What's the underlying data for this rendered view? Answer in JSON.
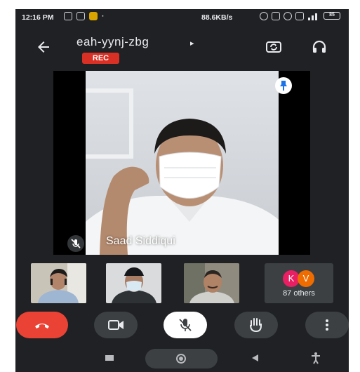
{
  "status_bar": {
    "time": "12:16 PM",
    "dot": "·",
    "speed": "88.6KB/s",
    "battery": "85"
  },
  "header": {
    "meeting_code": "eah-yynj-zbg",
    "arrow": "▸",
    "rec_badge": "REC",
    "icons": [
      "back-arrow-icon",
      "switch-camera-icon",
      "headphones-icon"
    ]
  },
  "main_video": {
    "participant_name": "Saad Siddiqui",
    "muted": true,
    "pinned": true
  },
  "thumbnails": {
    "others_avatars": [
      {
        "letter": "K",
        "color": "#e91e63"
      },
      {
        "letter": "V",
        "color": "#ef6c00"
      }
    ],
    "others_label": "87 others"
  },
  "controls": {
    "items": [
      "end-call",
      "camera",
      "microphone-muted",
      "raise-hand",
      "more-options"
    ],
    "end_call_color": "#ea4335"
  },
  "colors": {
    "background": "#202124",
    "control": "#3c4043",
    "rec": "#d93025"
  }
}
